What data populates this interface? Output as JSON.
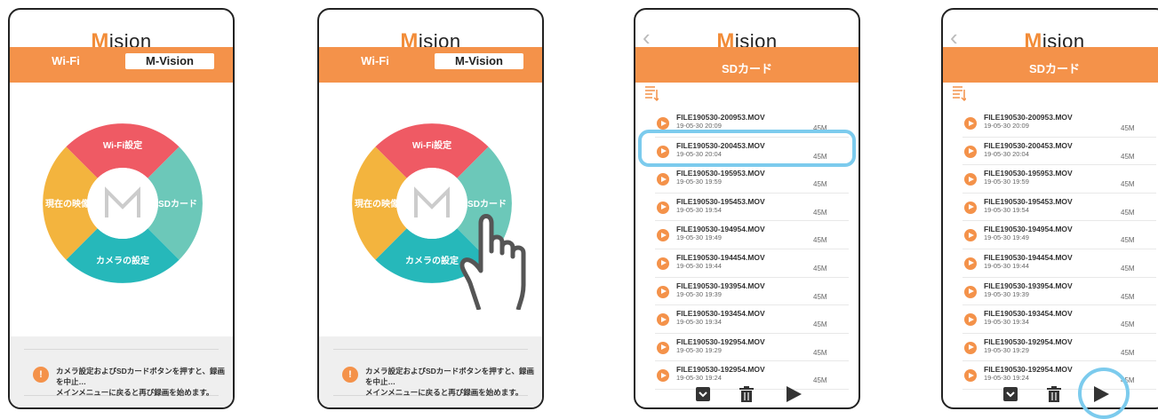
{
  "app": {
    "logo_text": "ision"
  },
  "home": {
    "tabs": {
      "wifi": "Wi-Fi",
      "mvision": "M-Vision"
    },
    "wheel": {
      "top": "Wi-Fi設定",
      "right": "SDカード",
      "bottom": "カメラの設定",
      "left": "現在の映像"
    },
    "warning": {
      "line1": "カメラ設定およびSDカードボタンを押すと、録画を中止…",
      "line2": "メインメニューに戻ると再び録画を始めます。"
    }
  },
  "sd": {
    "title": "SDカード",
    "files": [
      {
        "name": "FILE190530-200953.MOV",
        "date": "19-05-30 20:09",
        "size": "45M"
      },
      {
        "name": "FILE190530-200453.MOV",
        "date": "19-05-30 20:04",
        "size": "45M"
      },
      {
        "name": "FILE190530-195953.MOV",
        "date": "19-05-30 19:59",
        "size": "45M"
      },
      {
        "name": "FILE190530-195453.MOV",
        "date": "19-05-30 19:54",
        "size": "45M"
      },
      {
        "name": "FILE190530-194954.MOV",
        "date": "19-05-30 19:49",
        "size": "45M"
      },
      {
        "name": "FILE190530-194454.MOV",
        "date": "19-05-30 19:44",
        "size": "45M"
      },
      {
        "name": "FILE190530-193954.MOV",
        "date": "19-05-30 19:39",
        "size": "45M"
      },
      {
        "name": "FILE190530-193454.MOV",
        "date": "19-05-30 19:34",
        "size": "45M"
      },
      {
        "name": "FILE190530-192954.MOV",
        "date": "19-05-30 19:29",
        "size": "45M"
      },
      {
        "name": "FILE190530-192954.MOV",
        "date": "19-05-30 19:24",
        "size": "45M"
      }
    ]
  },
  "colors": {
    "orange": "#f4924a",
    "red": "#ef5a64",
    "teal": "#6cc8b9",
    "yellow": "#f3b43e",
    "cyan": "#26b8ba",
    "highlight": "#7ccbed"
  }
}
